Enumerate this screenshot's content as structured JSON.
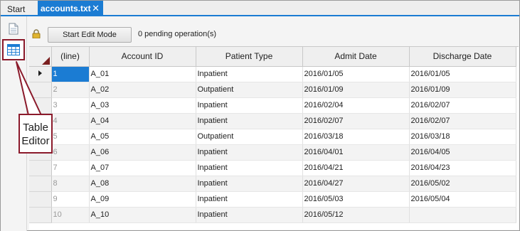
{
  "tabs": [
    {
      "label": "Start",
      "active": false
    },
    {
      "label": "accounts.txt",
      "active": true,
      "close_glyph": "✕"
    }
  ],
  "toolbar": {
    "edit_button_label": "Start Edit Mode",
    "pending_text": "0 pending operation(s)"
  },
  "sidebar": {
    "icons": [
      "document-icon",
      "table-editor-icon"
    ]
  },
  "table": {
    "columns": [
      "(line)",
      "Account ID",
      "Patient Type",
      "Admit Date",
      "Discharge Date"
    ],
    "rows": [
      {
        "line": "1",
        "account_id": "A_01",
        "patient_type": "Inpatient",
        "admit_date": "2016/01/05",
        "discharge_date": "2016/01/05"
      },
      {
        "line": "2",
        "account_id": "A_02",
        "patient_type": "Outpatient",
        "admit_date": "2016/01/09",
        "discharge_date": "2016/01/09"
      },
      {
        "line": "3",
        "account_id": "A_03",
        "patient_type": "Inpatient",
        "admit_date": "2016/02/04",
        "discharge_date": "2016/02/07"
      },
      {
        "line": "4",
        "account_id": "A_04",
        "patient_type": "Inpatient",
        "admit_date": "2016/02/07",
        "discharge_date": "2016/02/07"
      },
      {
        "line": "5",
        "account_id": "A_05",
        "patient_type": "Outpatient",
        "admit_date": "2016/03/18",
        "discharge_date": "2016/03/18"
      },
      {
        "line": "6",
        "account_id": "A_06",
        "patient_type": "Inpatient",
        "admit_date": "2016/04/01",
        "discharge_date": "2016/04/05"
      },
      {
        "line": "7",
        "account_id": "A_07",
        "patient_type": "Inpatient",
        "admit_date": "2016/04/21",
        "discharge_date": "2016/04/23"
      },
      {
        "line": "8",
        "account_id": "A_08",
        "patient_type": "Inpatient",
        "admit_date": "2016/04/27",
        "discharge_date": "2016/05/02"
      },
      {
        "line": "9",
        "account_id": "A_09",
        "patient_type": "Inpatient",
        "admit_date": "2016/05/03",
        "discharge_date": "2016/05/04"
      },
      {
        "line": "10",
        "account_id": "A_10",
        "patient_type": "Inpatient",
        "admit_date": "2016/05/12",
        "discharge_date": ""
      }
    ]
  },
  "callout": {
    "line1": "Table",
    "line2": "Editor"
  },
  "colors": {
    "accent": "#1b7cd3",
    "callout_border": "#8b1a2b"
  }
}
